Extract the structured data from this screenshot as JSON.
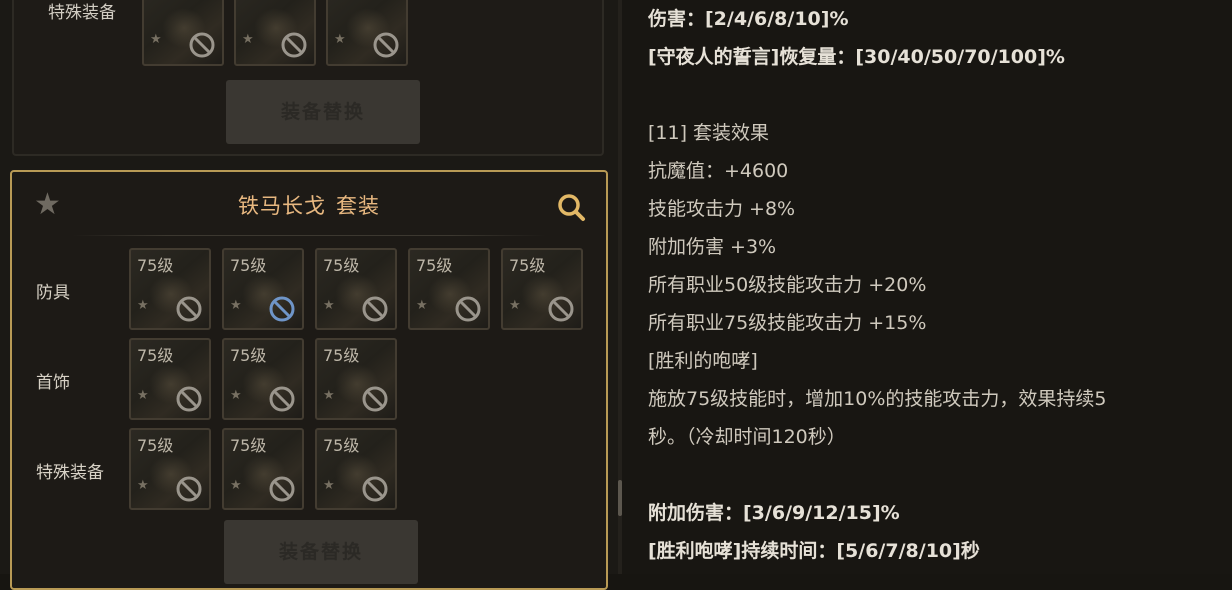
{
  "left": {
    "prev_set": {
      "row_label": "特殊装备",
      "slot_count": 3,
      "swap_button": "装备替换"
    },
    "set": {
      "title_name": "铁马长戈",
      "title_suffix": "套装",
      "icons": {
        "star": "star-icon",
        "search": "magnify-icon"
      },
      "rows": [
        {
          "label": "防具",
          "slots": [
            "75级",
            "75级",
            "75级",
            "75级",
            "75级"
          ],
          "highlight_slot": 1
        },
        {
          "label": "首饰",
          "slots": [
            "75级",
            "75级",
            "75级"
          ]
        },
        {
          "label": "特殊装备",
          "slots": [
            "75级",
            "75级",
            "75级"
          ]
        }
      ],
      "swap_button": "装备替换"
    }
  },
  "right": {
    "partial_top": "伤害：[2/4/6/8/10]%",
    "lines": [
      {
        "text": "[守夜人的誓言]恢复量：[30/40/50/70/100]%",
        "bold": true
      },
      {
        "text": "",
        "bold": false
      },
      {
        "text": "[11] 套装效果",
        "bold": false
      },
      {
        "text": "抗魔值：+4600",
        "bold": false
      },
      {
        "text": "技能攻击力 +8%",
        "bold": false
      },
      {
        "text": "附加伤害 +3%",
        "bold": false
      },
      {
        "text": "所有职业50级技能攻击力 +20%",
        "bold": false
      },
      {
        "text": "所有职业75级技能攻击力 +15%",
        "bold": false
      },
      {
        "text": "[胜利的咆哮]",
        "bold": false
      },
      {
        "text": "施放75级技能时，增加10%的技能攻击力，效果持续5",
        "bold": false
      },
      {
        "text": "秒。（冷却时间120秒）",
        "bold": false
      },
      {
        "text": "",
        "bold": false
      },
      {
        "text": "附加伤害：[3/6/9/12/15]%",
        "bold": true
      },
      {
        "text": "[胜利咆哮]持续时间：[5/6/7/8/10]秒",
        "bold": true
      }
    ]
  },
  "colors": {
    "accent_gold": "#b89a55",
    "title": "#e8b880"
  }
}
